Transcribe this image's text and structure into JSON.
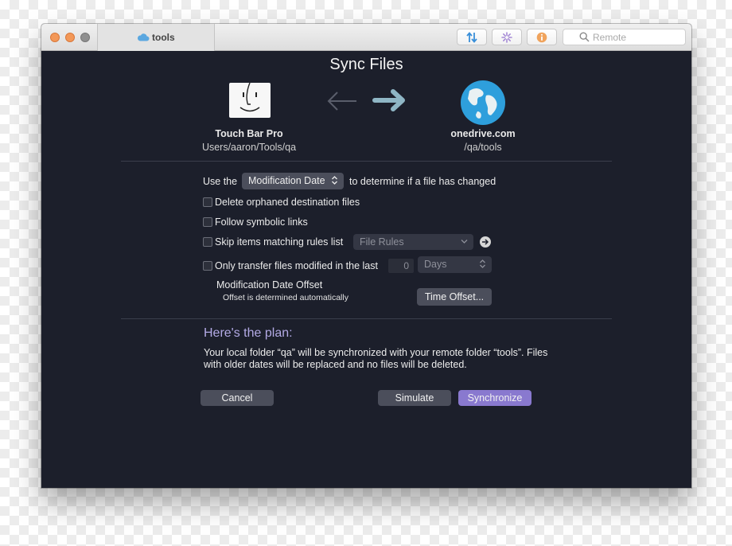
{
  "titlebar": {
    "tab_label": "tools",
    "search_placeholder": "Remote"
  },
  "heading": "Sync Files",
  "source": {
    "name": "Touch Bar Pro",
    "path": "Users/aaron/Tools/qa"
  },
  "destination": {
    "name": "onedrive.com",
    "path": "/qa/tools"
  },
  "options": {
    "use_the": "Use the",
    "compare_method": "Modification Date",
    "to_determine": "to determine if a file has changed",
    "delete_orphaned": "Delete orphaned destination files",
    "follow_symlinks": "Follow symbolic links",
    "skip_items": "Skip items matching rules list",
    "rules_list": "File Rules",
    "only_transfer": "Only transfer files modified in the last",
    "days_count": "0",
    "days_unit": "Days",
    "offset_title": "Modification Date Offset",
    "offset_subtitle": "Offset is determined automatically",
    "time_offset_button": "Time Offset..."
  },
  "plan": {
    "title": "Here's the plan:",
    "text": "Your local folder “qa” will be synchronized with your remote folder “tools”. Files with older dates will be replaced and no files will be deleted."
  },
  "buttons": {
    "cancel": "Cancel",
    "simulate": "Simulate",
    "synchronize": "Synchronize"
  },
  "colors": {
    "background": "#1c1f2b",
    "accent": "#8979cf",
    "plan_title": "#b3aae5",
    "control": "#4b4e5b"
  }
}
